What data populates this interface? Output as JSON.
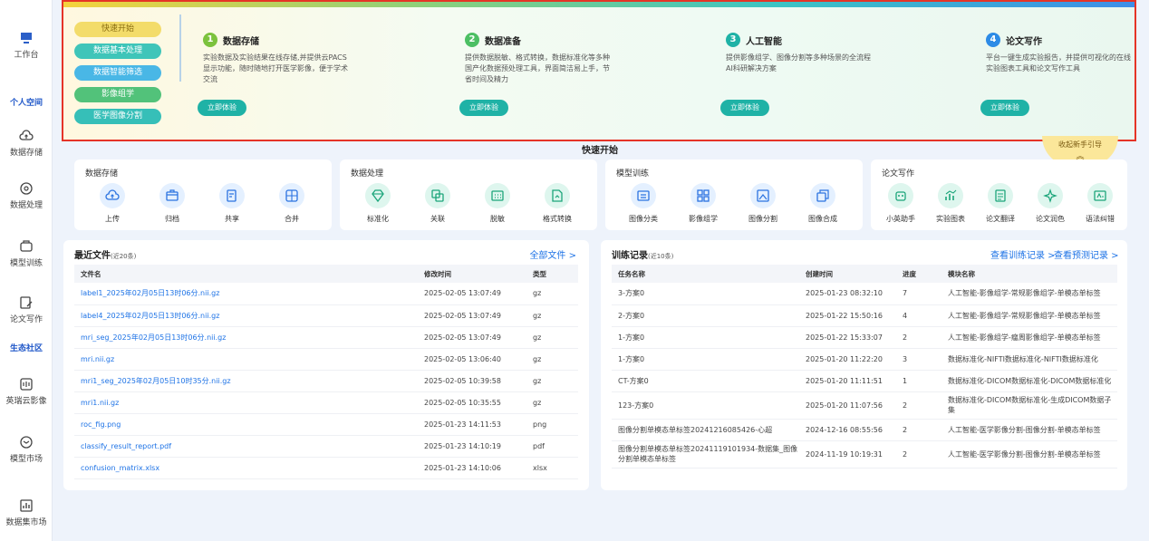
{
  "sidebar": {
    "workbench": "工作台",
    "personal_section": "个人空间",
    "items_personal": [
      "数据存储",
      "数据处理",
      "模型训练",
      "论文写作"
    ],
    "eco_section": "生态社区",
    "items_eco": [
      "英瑞云影像",
      "模型市场",
      "数据集市场"
    ]
  },
  "banner": {
    "pills": [
      {
        "label": "快速开始",
        "color": "#f3dc6a",
        "text": "#8a6d12"
      },
      {
        "label": "数据基本处理",
        "color": "#3fc5b9",
        "text": "#ffffff"
      },
      {
        "label": "数据智能筛选",
        "color": "#49b7e6",
        "text": "#ffffff"
      },
      {
        "label": "影像组学",
        "color": "#52c27a",
        "text": "#ffffff"
      },
      {
        "label": "医学图像分割",
        "color": "#36bfb8",
        "text": "#ffffff"
      }
    ],
    "steps": [
      {
        "num": "1",
        "title": "数据存储",
        "desc": "实验数据及实验结果在线存储,并提供云PACS显示功能，随时随地打开医学影像，便于学术交流",
        "color": "#7cc23d"
      },
      {
        "num": "2",
        "title": "数据准备",
        "desc": "提供数据脱敏、格式转换，数据标准化等多种国产化数据预处理工具，界面简洁易上手，节省时间及精力",
        "color": "#4cbf63"
      },
      {
        "num": "3",
        "title": "人工智能",
        "desc": "提供影像组学、图像分割等多种场景的全流程AI科研解决方案",
        "color": "#1fb2a6"
      },
      {
        "num": "4",
        "title": "论文写作",
        "desc": "平台一键生成实验报告，并提供可视化的在线实验图表工具和论文写作工具",
        "color": "#2d8be6"
      }
    ],
    "try_label": "立即体验"
  },
  "quick_start_title": "快速开始",
  "guide_collapse": "收起新手引导",
  "tool_groups": [
    {
      "category": "数据存储",
      "tools": [
        {
          "label": "上传",
          "icon": "cloud-upload-icon"
        },
        {
          "label": "归档",
          "icon": "archive-box-icon"
        },
        {
          "label": "共享",
          "icon": "share-doc-icon"
        },
        {
          "label": "合并",
          "icon": "merge-icon"
        }
      ]
    },
    {
      "category": "数据处理",
      "tools": [
        {
          "label": "标准化",
          "icon": "diamond-icon"
        },
        {
          "label": "关联",
          "icon": "link-squares-icon"
        },
        {
          "label": "脱敏",
          "icon": "grid-dots-icon"
        },
        {
          "label": "格式转换",
          "icon": "file-convert-icon"
        }
      ]
    },
    {
      "category": "模型训练",
      "tools": [
        {
          "label": "图像分类",
          "icon": "image-list-icon"
        },
        {
          "label": "影像组学",
          "icon": "apps-icon"
        },
        {
          "label": "图像分割",
          "icon": "image-crop-icon"
        },
        {
          "label": "图像合成",
          "icon": "image-stack-icon"
        }
      ]
    },
    {
      "category": "论文写作",
      "tools": [
        {
          "label": "小英助手",
          "icon": "robot-icon"
        },
        {
          "label": "实验图表",
          "icon": "chart-icon"
        },
        {
          "label": "论文翻译",
          "icon": "doc-translate-icon"
        },
        {
          "label": "论文润色",
          "icon": "sparkle-icon"
        },
        {
          "label": "语法纠错",
          "icon": "grammar-icon"
        }
      ]
    }
  ],
  "recent_files": {
    "title": "最近文件",
    "subtitle": "(近20条)",
    "link": "全部文件 >",
    "columns": [
      "文件名",
      "修改时间",
      "类型"
    ],
    "rows": [
      [
        "label1_2025年02月05日13时06分.nii.gz",
        "2025-02-05 13:07:49",
        "gz"
      ],
      [
        "label4_2025年02月05日13时06分.nii.gz",
        "2025-02-05 13:07:49",
        "gz"
      ],
      [
        "mri_seg_2025年02月05日13时06分.nii.gz",
        "2025-02-05 13:07:49",
        "gz"
      ],
      [
        "mri.nii.gz",
        "2025-02-05 13:06:40",
        "gz"
      ],
      [
        "mri1_seg_2025年02月05日10时35分.nii.gz",
        "2025-02-05 10:39:58",
        "gz"
      ],
      [
        "mri1.nii.gz",
        "2025-02-05 10:35:55",
        "gz"
      ],
      [
        "roc_fig.png",
        "2025-01-23 14:11:53",
        "png"
      ],
      [
        "classify_result_report.pdf",
        "2025-01-23 14:10:19",
        "pdf"
      ],
      [
        "confusion_matrix.xlsx",
        "2025-01-23 14:10:06",
        "xlsx"
      ]
    ]
  },
  "training": {
    "title": "训练记录",
    "subtitle": "(近10条)",
    "link1": "查看训练记录 >",
    "link2": "查看预测记录 >",
    "columns": [
      "任务名称",
      "创建时间",
      "进度",
      "模块名称"
    ],
    "rows": [
      [
        "3-方案0",
        "2025-01-23 08:32:10",
        "7",
        "人工智能-影像组学-常规影像组学-单模态单标签"
      ],
      [
        "2-方案0",
        "2025-01-22 15:50:16",
        "4",
        "人工智能-影像组学-常规影像组学-单模态单标签"
      ],
      [
        "1-方案0",
        "2025-01-22 15:33:07",
        "2",
        "人工智能-影像组学-瘤周影像组学-单模态单标签"
      ],
      [
        "1-方案0",
        "2025-01-20 11:22:20",
        "3",
        "数据标准化-NIFTI数据标准化-NIFTI数据标准化"
      ],
      [
        "CT-方案0",
        "2025-01-20 11:11:51",
        "1",
        "数据标准化-DICOM数据标准化-DICOM数据标准化"
      ],
      [
        "123-方案0",
        "2025-01-20 11:07:56",
        "2",
        "数据标准化-DICOM数据标准化-生成DICOM数据子集"
      ],
      [
        "图像分割单模态单标签20241216085426-心超",
        "2024-12-16 08:55:56",
        "2",
        "人工智能-医学影像分割-图像分割-单模态单标签"
      ],
      [
        "图像分割单模态单标签20241119101934-数据集_图像分割单模态单标签",
        "2024-11-19 10:19:31",
        "2",
        "人工智能-医学影像分割-图像分割-单模态单标签"
      ]
    ]
  }
}
